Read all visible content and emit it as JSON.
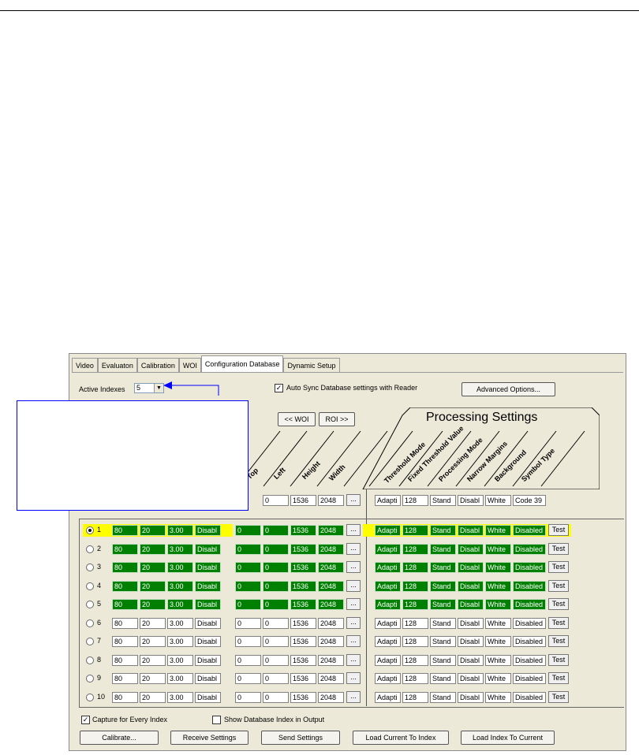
{
  "tabs": [
    "Video",
    "Evaluaton",
    "Calibration",
    "WOI",
    "Configuration Database",
    "Dynamic Setup"
  ],
  "active_tab_index": 4,
  "active_indexes": {
    "label": "Active Indexes",
    "value": "5"
  },
  "auto_sync": {
    "label": "Auto Sync Database settings with Reader",
    "checked": true
  },
  "advanced_options_label": "Advanced Options...",
  "woi_nav": {
    "prev_label": "<< WOI",
    "next_label": "ROI >>"
  },
  "processing_title": "Processing Settings",
  "woi_headers": [
    "Top",
    "Left",
    "Height",
    "Width"
  ],
  "proc_headers": [
    "Threshold Mode",
    "Fixed Threshold Value",
    "Processing Mode",
    "Narrow Margins",
    "Background",
    "Symbol Type"
  ],
  "current_row": {
    "woi": [
      "0",
      "1536",
      "2048"
    ],
    "proc": [
      "Adapti",
      "128",
      "Stand",
      "Disabl",
      "White",
      "Code 39"
    ]
  },
  "more_label": "...",
  "test_label": "Test",
  "rows": [
    {
      "index": "1",
      "selected": true,
      "active": true,
      "capture": [
        "80",
        "20",
        "3.00",
        "Disabl"
      ],
      "woi": [
        "0",
        "0",
        "1536",
        "2048"
      ],
      "proc": [
        "Adapti",
        "128",
        "Stand",
        "Disabl",
        "White",
        "Disabled"
      ]
    },
    {
      "index": "2",
      "selected": false,
      "active": true,
      "capture": [
        "80",
        "20",
        "3.00",
        "Disabl"
      ],
      "woi": [
        "0",
        "0",
        "1536",
        "2048"
      ],
      "proc": [
        "Adapti",
        "128",
        "Stand",
        "Disabl",
        "White",
        "Disabled"
      ]
    },
    {
      "index": "3",
      "selected": false,
      "active": true,
      "capture": [
        "80",
        "20",
        "3.00",
        "Disabl"
      ],
      "woi": [
        "0",
        "0",
        "1536",
        "2048"
      ],
      "proc": [
        "Adapti",
        "128",
        "Stand",
        "Disabl",
        "White",
        "Disabled"
      ]
    },
    {
      "index": "4",
      "selected": false,
      "active": true,
      "capture": [
        "80",
        "20",
        "3.00",
        "Disabl"
      ],
      "woi": [
        "0",
        "0",
        "1536",
        "2048"
      ],
      "proc": [
        "Adapti",
        "128",
        "Stand",
        "Disabl",
        "White",
        "Disabled"
      ]
    },
    {
      "index": "5",
      "selected": false,
      "active": true,
      "capture": [
        "80",
        "20",
        "3.00",
        "Disabl"
      ],
      "woi": [
        "0",
        "0",
        "1536",
        "2048"
      ],
      "proc": [
        "Adapti",
        "128",
        "Stand",
        "Disabl",
        "White",
        "Disabled"
      ]
    },
    {
      "index": "6",
      "selected": false,
      "active": false,
      "capture": [
        "80",
        "20",
        "3.00",
        "Disabl"
      ],
      "woi": [
        "0",
        "0",
        "1536",
        "2048"
      ],
      "proc": [
        "Adapti",
        "128",
        "Stand",
        "Disabl",
        "White",
        "Disabled"
      ]
    },
    {
      "index": "7",
      "selected": false,
      "active": false,
      "capture": [
        "80",
        "20",
        "3.00",
        "Disabl"
      ],
      "woi": [
        "0",
        "0",
        "1536",
        "2048"
      ],
      "proc": [
        "Adapti",
        "128",
        "Stand",
        "Disabl",
        "White",
        "Disabled"
      ]
    },
    {
      "index": "8",
      "selected": false,
      "active": false,
      "capture": [
        "80",
        "20",
        "3.00",
        "Disabl"
      ],
      "woi": [
        "0",
        "0",
        "1536",
        "2048"
      ],
      "proc": [
        "Adapti",
        "128",
        "Stand",
        "Disabl",
        "White",
        "Disabled"
      ]
    },
    {
      "index": "9",
      "selected": false,
      "active": false,
      "capture": [
        "80",
        "20",
        "3.00",
        "Disabl"
      ],
      "woi": [
        "0",
        "0",
        "1536",
        "2048"
      ],
      "proc": [
        "Adapti",
        "128",
        "Stand",
        "Disabl",
        "White",
        "Disabled"
      ]
    },
    {
      "index": "10",
      "selected": false,
      "active": false,
      "capture": [
        "80",
        "20",
        "3.00",
        "Disabl"
      ],
      "woi": [
        "0",
        "0",
        "1536",
        "2048"
      ],
      "proc": [
        "Adapti",
        "128",
        "Stand",
        "Disabl",
        "White",
        "Disabled"
      ]
    }
  ],
  "capture_every": {
    "label": "Capture for Every Index",
    "checked": true
  },
  "show_db_index": {
    "label": "Show Database Index in Output",
    "checked": false
  },
  "buttons": {
    "calibrate": "Calibrate...",
    "receive": "Receive Settings",
    "send": "Send Settings",
    "load_current": "Load Current To Index",
    "load_index": "Load Index To Current"
  },
  "colors": {
    "active_cell": "#008000",
    "selected_row": "#ffff00",
    "callout_border": "#0000ff"
  }
}
